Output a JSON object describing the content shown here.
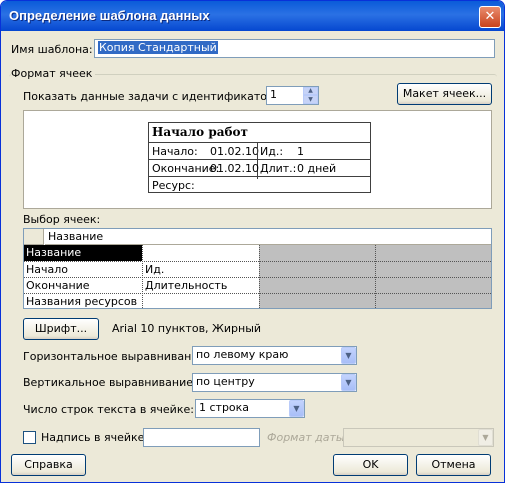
{
  "window": {
    "title": "Определение шаблона данных",
    "close_glyph": "✕"
  },
  "template_name": {
    "label": "Имя шаблона:",
    "value": "Копия Стандартный"
  },
  "cell_format": {
    "label": "Формат ячеек",
    "show_task_label": "Показать данные задачи с идентификатором:",
    "task_id": "1",
    "cell_layout_button": "Макет ячеек..."
  },
  "preview_card": {
    "title": "Начало работ",
    "start_label": "Начало:",
    "start_value": "01.02.10",
    "id_label": "Ид.:",
    "id_value": "1",
    "finish_label": "Окончание:",
    "finish_value": "01.02.10",
    "duration_label": "Длит.:",
    "duration_value": "0 дней",
    "resource_label": "Ресурс:"
  },
  "cell_selection": {
    "label": "Выбор ячеек:",
    "header_cell": "Название",
    "rows": [
      [
        "Название",
        "",
        "",
        ""
      ],
      [
        "Начало",
        "Ид.",
        "",
        ""
      ],
      [
        "Окончание",
        "Длительность",
        "",
        ""
      ],
      [
        "Названия ресурсов",
        "",
        "",
        ""
      ]
    ]
  },
  "font": {
    "button": "Шрифт...",
    "description": "Arial 10 пунктов, Жирный"
  },
  "horizontal_align": {
    "label": "Горизонтальное выравнивание:",
    "value": "по левому краю"
  },
  "vertical_align": {
    "label": "Вертикальное выравнивание:",
    "value": "по центру"
  },
  "text_lines": {
    "label": "Число строк текста в ячейке:",
    "value": "1 строка"
  },
  "cell_caption": {
    "label": "Надпись в ячейке:",
    "checked": false,
    "value": ""
  },
  "date_format": {
    "label": "Формат даты:",
    "value": ""
  },
  "buttons": {
    "help": "Справка",
    "ok": "OK",
    "cancel": "Отмена"
  },
  "colors": {
    "titlebar": "#0a5bd9",
    "selection": "#316ac5",
    "grid_disabled": "#bfbfbf"
  }
}
